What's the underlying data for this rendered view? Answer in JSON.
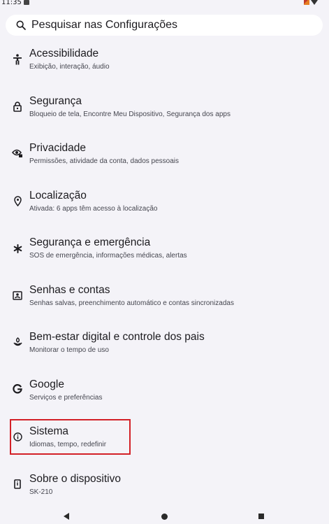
{
  "status_bar": {
    "time": "11:35"
  },
  "search": {
    "label": "Pesquisar nas Configurações"
  },
  "items": [
    {
      "title": "Acessibilidade",
      "subtitle": "Exibição, interação, áudio",
      "icon": "accessibility-icon"
    },
    {
      "title": "Segurança",
      "subtitle": "Bloqueio de tela, Encontre Meu Dispositivo, Segurança dos apps",
      "icon": "lock-icon"
    },
    {
      "title": "Privacidade",
      "subtitle": "Permissões, atividade da conta, dados pessoais",
      "icon": "privacy-eye-icon"
    },
    {
      "title": "Localização",
      "subtitle": "Ativada: 6 apps têm acesso à localização",
      "icon": "location-pin-icon"
    },
    {
      "title": "Segurança e emergência",
      "subtitle": "SOS de emergência, informações médicas, alertas",
      "icon": "asterisk-icon"
    },
    {
      "title": "Senhas e contas",
      "subtitle": "Senhas salvas, preenchimento automático e contas sincronizadas",
      "icon": "account-box-icon"
    },
    {
      "title": "Bem-estar digital e controle dos pais",
      "subtitle": "Monitorar o tempo de uso",
      "icon": "wellbeing-icon"
    },
    {
      "title": "Google",
      "subtitle": "Serviços e preferências",
      "icon": "google-icon"
    },
    {
      "title": "Sistema",
      "subtitle": "Idiomas, tempo, redefinir",
      "icon": "info-icon"
    },
    {
      "title": "Sobre o dispositivo",
      "subtitle": "SK-210",
      "icon": "device-icon"
    }
  ],
  "colors": {
    "background": "#f4f3f8",
    "highlight": "#d32027"
  }
}
